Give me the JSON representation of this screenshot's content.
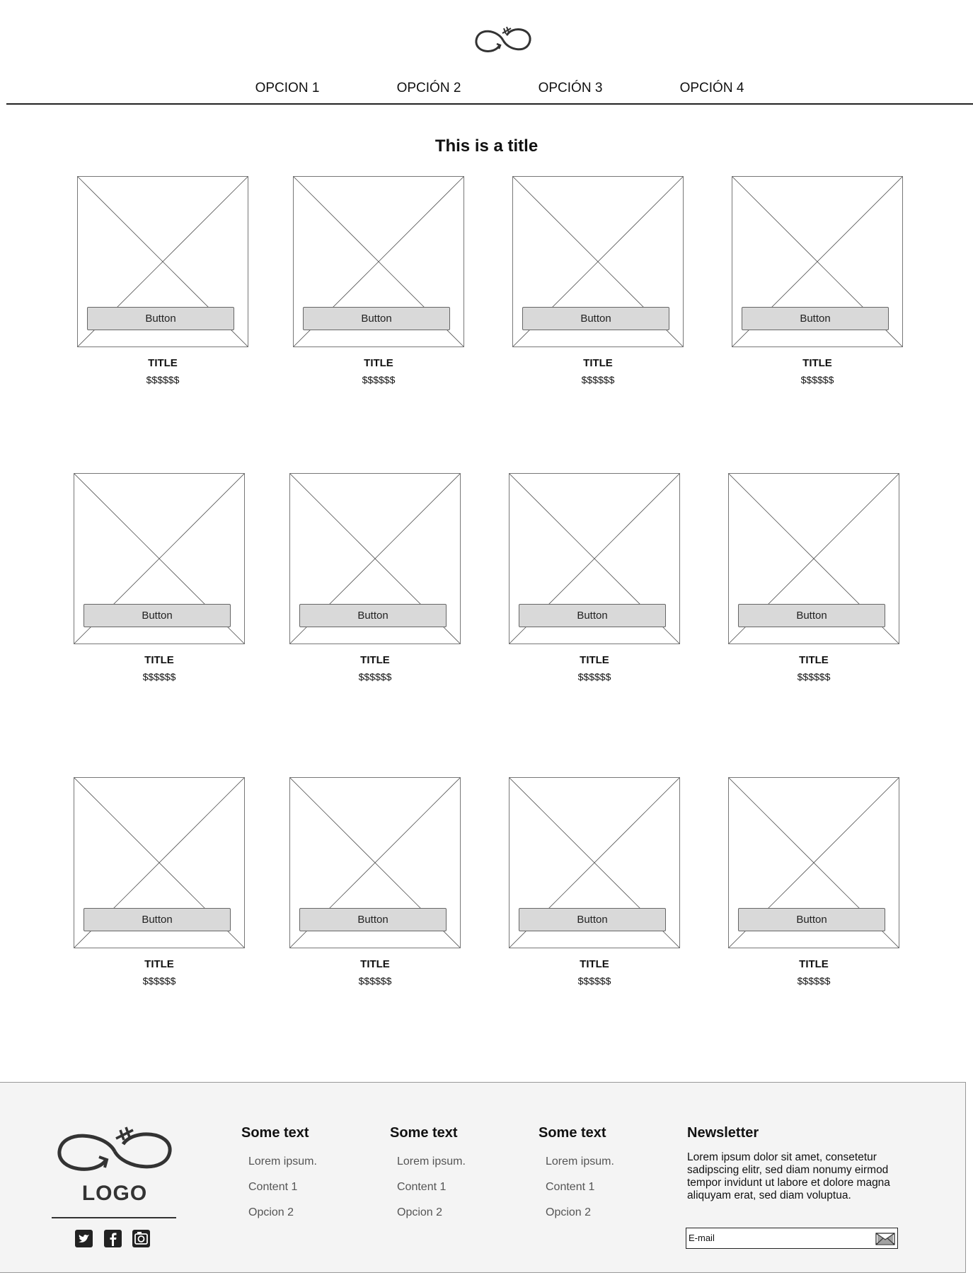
{
  "header": {
    "logo_icon": "infinity-arrow-logo-icon",
    "nav": [
      "OPCION 1",
      "OPCIÓN 2",
      "OPCIÓN 3",
      "OPCIÓN 4"
    ]
  },
  "main": {
    "title": "This is a title",
    "products": [
      {
        "button": "Button",
        "title": "TITLE",
        "price": "$$$$$$"
      },
      {
        "button": "Button",
        "title": "TITLE",
        "price": "$$$$$$"
      },
      {
        "button": "Button",
        "title": "TITLE",
        "price": "$$$$$$"
      },
      {
        "button": "Button",
        "title": "TITLE",
        "price": "$$$$$$"
      },
      {
        "button": "Button",
        "title": "TITLE",
        "price": "$$$$$$"
      },
      {
        "button": "Button",
        "title": "TITLE",
        "price": "$$$$$$"
      },
      {
        "button": "Button",
        "title": "TITLE",
        "price": "$$$$$$"
      },
      {
        "button": "Button",
        "title": "TITLE",
        "price": "$$$$$$"
      },
      {
        "button": "Button",
        "title": "TITLE",
        "price": "$$$$$$"
      },
      {
        "button": "Button",
        "title": "TITLE",
        "price": "$$$$$$"
      },
      {
        "button": "Button",
        "title": "TITLE",
        "price": "$$$$$$"
      },
      {
        "button": "Button",
        "title": "TITLE",
        "price": "$$$$$$"
      }
    ]
  },
  "footer": {
    "logo_text": "LOGO",
    "social": [
      "twitter-icon",
      "facebook-icon",
      "instagram-icon"
    ],
    "columns": [
      {
        "heading": "Some text",
        "links": [
          "Lorem ipsum.",
          "Content 1",
          "Opcion 2"
        ]
      },
      {
        "heading": "Some text",
        "links": [
          "Lorem ipsum.",
          "Content 1",
          "Opcion 2"
        ]
      },
      {
        "heading": "Some text",
        "links": [
          "Lorem ipsum.",
          "Content 1",
          "Opcion 2"
        ]
      }
    ],
    "newsletter": {
      "heading": "Newsletter",
      "text": "Lorem ipsum dolor sit amet, consetetur sadipscing elitr, sed diam nonumy eirmod tempor invidunt ut labore et dolore magna aliquyam erat, sed diam voluptua.",
      "email_placeholder": "E-mail",
      "send_icon": "envelope-icon"
    }
  }
}
